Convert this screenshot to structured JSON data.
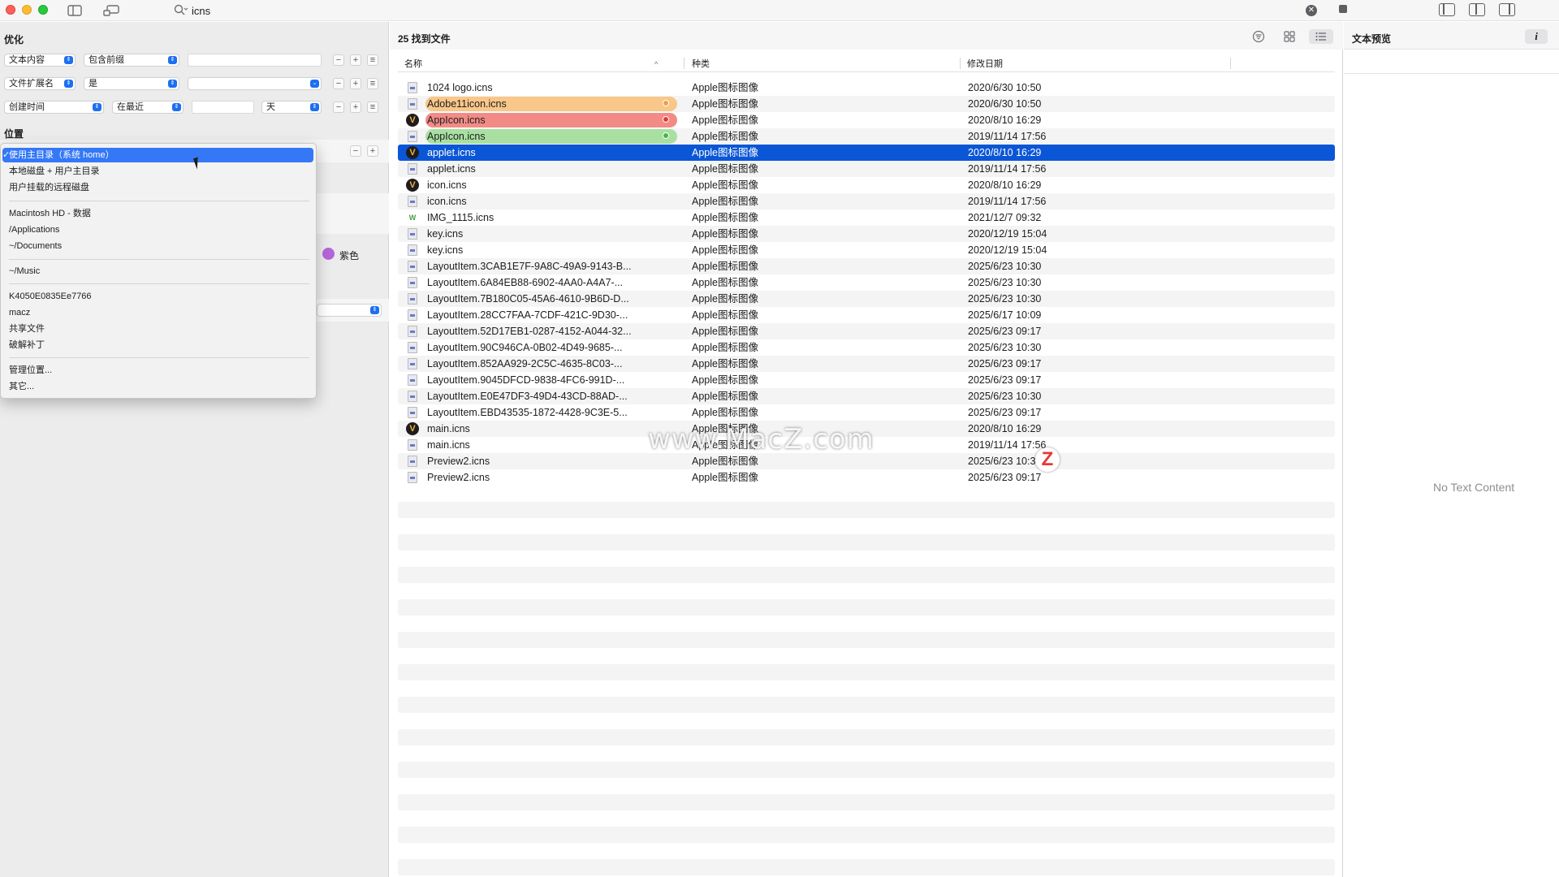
{
  "search": {
    "query": "icns"
  },
  "left": {
    "section_optimize": "优化",
    "criteria": [
      {
        "field": "文本内容",
        "op": "包含前缀",
        "value": "",
        "unit": ""
      },
      {
        "field": "文件扩展名",
        "op": "是",
        "value": "",
        "unit": ""
      },
      {
        "field": "创建时间",
        "op": "在最近",
        "value": "",
        "unit": "天"
      }
    ],
    "section_location": "位置",
    "purple_tag": "紫色",
    "location_menu": [
      {
        "label": "使用主目录（系统 home）",
        "selected": true
      },
      {
        "label": "本地磁盘 + 用户主目录"
      },
      {
        "label": "用户挂载的远程磁盘"
      },
      {
        "label": "Macintosh HD - 数据"
      },
      {
        "label": "/Applications"
      },
      {
        "label": "~/Documents"
      },
      {
        "label": "~/Music"
      },
      {
        "label": "K4050E0835Ee7766"
      },
      {
        "label": "macz"
      },
      {
        "label": "共享文件"
      },
      {
        "label": "破解补丁"
      },
      {
        "label": "管理位置..."
      },
      {
        "label": "其它..."
      }
    ]
  },
  "results": {
    "count_label": "25 找到文件",
    "columns": {
      "name": "名称",
      "kind": "种类",
      "date": "修改日期"
    },
    "rows": [
      {
        "name": "1024 logo.icns",
        "kind": "Apple图标图像",
        "date": "2020/6/30 10:50",
        "icon": "doc-icon"
      },
      {
        "name": "Adobe11icon.icns",
        "kind": "Apple图标图像",
        "date": "2020/6/30 10:50",
        "icon": "doc-icon",
        "tag": "#f0a13a",
        "tag_bg": "#f9c789"
      },
      {
        "name": "AppIcon.icns",
        "kind": "Apple图标图像",
        "date": "2020/8/10 16:29",
        "icon": "v-icon",
        "tag": "#e53935",
        "tag_bg": "#f28b86"
      },
      {
        "name": "AppIcon.icns",
        "kind": "Apple图标图像",
        "date": "2019/11/14 17:56",
        "icon": "doc-icon",
        "tag": "#43b649",
        "tag_bg": "#a9e0a2"
      },
      {
        "name": "applet.icns",
        "kind": "Apple图标图像",
        "date": "2020/8/10 16:29",
        "icon": "v-icon",
        "selected": true
      },
      {
        "name": "applet.icns",
        "kind": "Apple图标图像",
        "date": "2019/11/14 17:56",
        "icon": "doc-icon"
      },
      {
        "name": "icon.icns",
        "kind": "Apple图标图像",
        "date": "2020/8/10 16:29",
        "icon": "v-icon"
      },
      {
        "name": "icon.icns",
        "kind": "Apple图标图像",
        "date": "2019/11/14 17:56",
        "icon": "doc-icon"
      },
      {
        "name": "IMG_1115.icns",
        "kind": "Apple图标图像",
        "date": "2021/12/7 09:32",
        "icon": "w-icon"
      },
      {
        "name": "key.icns",
        "kind": "Apple图标图像",
        "date": "2020/12/19 15:04",
        "icon": "doc-icon"
      },
      {
        "name": "key.icns",
        "kind": "Apple图标图像",
        "date": "2020/12/19 15:04",
        "icon": "doc-icon"
      },
      {
        "name": "LayoutItem.3CAB1E7F-9A8C-49A9-9143-B...",
        "kind": "Apple图标图像",
        "date": "2025/6/23 10:30",
        "icon": "doc-icon"
      },
      {
        "name": "LayoutItem.6A84EB88-6902-4AA0-A4A7-...",
        "kind": "Apple图标图像",
        "date": "2025/6/23 10:30",
        "icon": "doc-icon"
      },
      {
        "name": "LayoutItem.7B180C05-45A6-4610-9B6D-D...",
        "kind": "Apple图标图像",
        "date": "2025/6/23 10:30",
        "icon": "doc-icon"
      },
      {
        "name": "LayoutItem.28CC7FAA-7CDF-421C-9D30-...",
        "kind": "Apple图标图像",
        "date": "2025/6/17 10:09",
        "icon": "doc-icon"
      },
      {
        "name": "LayoutItem.52D17EB1-0287-4152-A044-32...",
        "kind": "Apple图标图像",
        "date": "2025/6/23 09:17",
        "icon": "doc-icon"
      },
      {
        "name": "LayoutItem.90C946CA-0B02-4D49-9685-...",
        "kind": "Apple图标图像",
        "date": "2025/6/23 10:30",
        "icon": "doc-icon"
      },
      {
        "name": "LayoutItem.852AA929-2C5C-4635-8C03-...",
        "kind": "Apple图标图像",
        "date": "2025/6/23 09:17",
        "icon": "doc-icon"
      },
      {
        "name": "LayoutItem.9045DFCD-9838-4FC6-991D-...",
        "kind": "Apple图标图像",
        "date": "2025/6/23 09:17",
        "icon": "doc-icon"
      },
      {
        "name": "LayoutItem.E0E47DF3-49D4-43CD-88AD-...",
        "kind": "Apple图标图像",
        "date": "2025/6/23 10:30",
        "icon": "doc-icon"
      },
      {
        "name": "LayoutItem.EBD43535-1872-4428-9C3E-5...",
        "kind": "Apple图标图像",
        "date": "2025/6/23 09:17",
        "icon": "doc-icon"
      },
      {
        "name": "main.icns",
        "kind": "Apple图标图像",
        "date": "2020/8/10 16:29",
        "icon": "v-icon"
      },
      {
        "name": "main.icns",
        "kind": "Apple图标图像",
        "date": "2019/11/14 17:56",
        "icon": "doc-icon"
      },
      {
        "name": "Preview2.icns",
        "kind": "Apple图标图像",
        "date": "2025/6/23 10:30",
        "icon": "doc-icon"
      },
      {
        "name": "Preview2.icns",
        "kind": "Apple图标图像",
        "date": "2025/6/23 09:17",
        "icon": "doc-icon"
      }
    ]
  },
  "preview": {
    "title": "文本预览",
    "info_label": "i",
    "empty_text": "No Text Content"
  },
  "watermark": {
    "letter": "Z",
    "text": "www.MacZ.com"
  },
  "colors": {
    "selection": "#0a56d6",
    "menu_highlight": "#3478f6",
    "accent": "#1d6ff2"
  }
}
